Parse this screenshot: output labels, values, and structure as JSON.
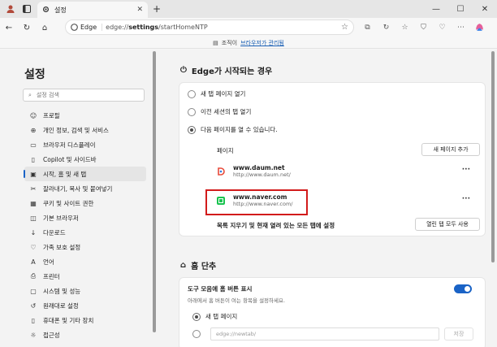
{
  "browser": {
    "tab_title": "설정",
    "omnibox_badge": "Edge",
    "url_prefix": "edge://",
    "url_bold": "settings",
    "url_suffix": "/startHomeNTP",
    "banner_text": "조직이",
    "banner_link": "브라우저가 관리됨"
  },
  "sidebar": {
    "title": "설정",
    "search_placeholder": "설정 검색",
    "items": [
      {
        "label": "프로필",
        "icon": "profile-icon"
      },
      {
        "label": "개인 정보, 검색 및 서비스",
        "icon": "lock-icon"
      },
      {
        "label": "브라우저 디스플레이",
        "icon": "display-icon"
      },
      {
        "label": "Copilot 및 사이드바",
        "icon": "sidebar-icon"
      },
      {
        "label": "시작, 홈 및 새 탭",
        "icon": "home-tab-icon",
        "active": true
      },
      {
        "label": "잘라내기, 복사 및 붙여넣기",
        "icon": "clipboard-icon"
      },
      {
        "label": "쿠키 및 사이트 권한",
        "icon": "cookie-icon"
      },
      {
        "label": "기본 브라우저",
        "icon": "browser-icon"
      },
      {
        "label": "다운로드",
        "icon": "download-icon"
      },
      {
        "label": "가족 보호 설정",
        "icon": "family-icon"
      },
      {
        "label": "언어",
        "icon": "language-icon"
      },
      {
        "label": "프린터",
        "icon": "printer-icon"
      },
      {
        "label": "시스템 및 성능",
        "icon": "system-icon"
      },
      {
        "label": "원래대로 설정",
        "icon": "reset-icon"
      },
      {
        "label": "휴대폰 및 기타 장치",
        "icon": "phone-icon"
      },
      {
        "label": "접근성",
        "icon": "accessibility-icon"
      }
    ]
  },
  "startup": {
    "title": "Edge가 시작되는 경우",
    "options": [
      "새 탭 페이지 열기",
      "이전 세션의 탭 열기",
      "다음 페이지를 열 수 있습니다."
    ],
    "selected": 2,
    "pages_header": "페이지",
    "add_page_button": "새 페이지 추가",
    "pages": [
      {
        "name": "www.daum.net",
        "url": "http://www.daum.net/"
      },
      {
        "name": "www.naver.com",
        "url": "http://www.naver.com/"
      }
    ],
    "clear_text": "목록 지우기 및 현재 열려 있는 모든 탭에 설정",
    "use_open_tabs_button": "열린 탭 모두 사용"
  },
  "home": {
    "title": "홈 단추",
    "toggle_label": "도구 모음에 홈 버튼 표시",
    "toggle_desc": "아래에서 홈 버튼이 여는 항목을 설정하세요.",
    "toggle_on": true,
    "option_new_tab": "새 탭 페이지",
    "url_placeholder": "edge://newtab/",
    "save_button": "저장"
  },
  "colors": {
    "accent": "#1a63c6",
    "highlight_box": "#d21b1b"
  }
}
